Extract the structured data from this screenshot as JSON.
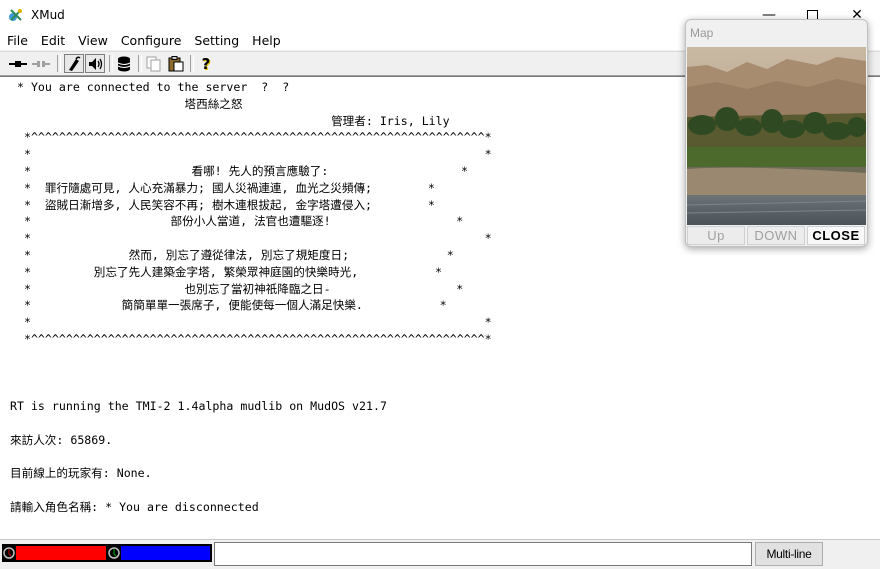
{
  "window": {
    "title": "XMud",
    "minimize_glyph": "—",
    "maximize_glyph": "☐",
    "close_glyph": "✕"
  },
  "menu": [
    "File",
    "Edit",
    "View",
    "Configure",
    "Setting",
    "Help"
  ],
  "toolbar": {
    "icons": [
      "connect-icon",
      "disconnect-icon",
      "script-icon",
      "sound-icon",
      "database-icon",
      "copy-icon",
      "paste-icon",
      "help-icon"
    ],
    "help_glyph": "?"
  },
  "terminal": {
    "lines": [
      " * You are connected to the server  ?  ?",
      "                         塔西絲之怒",
      "                                              管理者: Iris, Lily",
      "  *^^^^^^^^^^^^^^^^^^^^^^^^^^^^^^^^^^^^^^^^^^^^^^^^^^^^^^^^^^^^^^^^^*",
      "  *                                                                 *",
      "  *                       看哪! 先人的預言應驗了:                   *",
      "  *  罪行隨處可見, 人心充滿暴力; 國人災禍連連, 血光之災頻傳;        *",
      "  *  盜賊日漸增多, 人民笑容不再; 樹木連根拔起, 金字塔遭侵入;        *",
      "  *                    部份小人當道, 法官也遭驅逐!                  *",
      "  *                                                                 *",
      "  *              然而, 別忘了遵從律法, 別忘了規矩度日;              *",
      "  *         別忘了先人建築金字塔, 繁榮眾神庭園的快樂時光,           *",
      "  *                      也別忘了當初神祇降臨之日-                  *",
      "  *             簡簡單單一張席子, 便能使每一個人滿足快樂.           *",
      "  *                                                                 *",
      "  *^^^^^^^^^^^^^^^^^^^^^^^^^^^^^^^^^^^^^^^^^^^^^^^^^^^^^^^^^^^^^^^^^*",
      "",
      "",
      "",
      "RT is running the TMI-2 1.4alpha mudlib on MudOS v21.7",
      "",
      "來訪人次: 65869.",
      "",
      "目前線上的玩家有: None.",
      "",
      "請輸入角色名稱: * You are disconnected"
    ]
  },
  "status": {
    "hp_color": "#ff0000",
    "sp_color": "#0000ff",
    "hp_fill": 1.0,
    "sp_fill": 1.0,
    "command_value": "",
    "multiline_label": "Multi-line"
  },
  "map": {
    "title": "Map",
    "up_label": "Up",
    "down_label": "DOWN",
    "close_label": "CLOSE"
  }
}
